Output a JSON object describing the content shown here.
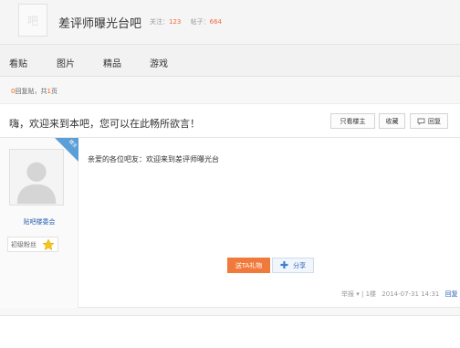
{
  "header": {
    "logo_text": "吧",
    "forum_name": "差评师曝光台吧",
    "followers_label": "关注：",
    "followers_count": "123",
    "posts_label": "帖子：",
    "posts_count": "664"
  },
  "tabs": [
    {
      "label": "看贴"
    },
    {
      "label": "图片"
    },
    {
      "label": "精品"
    },
    {
      "label": "游戏"
    }
  ],
  "pager": {
    "reply_count": "0",
    "reply_label": "回复贴，共",
    "page_count": "1",
    "page_label": "页"
  },
  "thread": {
    "title": "嗨，欢迎来到本吧，您可以在此畅所欲言！",
    "buttons": {
      "only_op": "只看楼主",
      "favorite": "收藏",
      "reply": "回复"
    }
  },
  "post": {
    "corner_label": "楼主",
    "username": "贴吧楼委会",
    "level_label": "初级粉丝",
    "content": "亲爱的各位吧友：欢迎来到差评师曝光台",
    "follow_label": "送TA礼物",
    "share_label": "分享",
    "meta": {
      "report": "举报",
      "floor": "1楼",
      "datetime": "2014-07-31 14:31",
      "reply": "回复"
    }
  },
  "colors": {
    "accent_orange": "#f07a3c",
    "link_blue": "#2d64b3",
    "corner_blue": "#5c9ed8"
  }
}
